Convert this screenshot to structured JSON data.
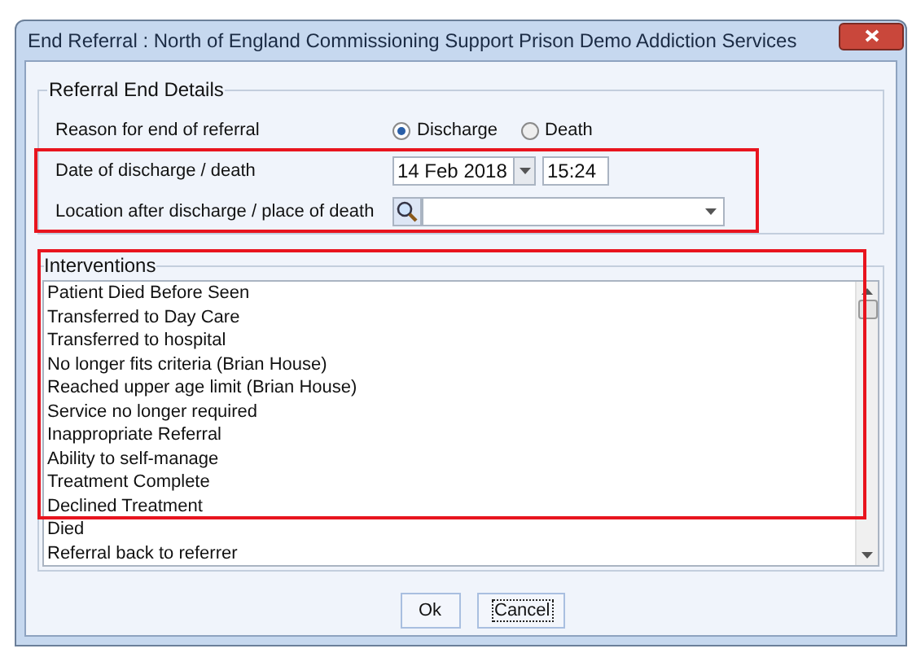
{
  "window": {
    "title": "End Referral : North of England Commissioning Support Prison Demo Addiction Services"
  },
  "details": {
    "title": "Referral End Details",
    "reason_label": "Reason for end of referral",
    "reasons": [
      {
        "label": "Discharge",
        "selected": true
      },
      {
        "label": "Death",
        "selected": false
      }
    ],
    "date_label": "Date of discharge / death",
    "date": "14 Feb 2018",
    "time": "15:24",
    "location_label": "Location after discharge / place of death"
  },
  "interventions": {
    "title": "Interventions",
    "items": [
      "Patient Died Before Seen",
      "Transferred to Day Care",
      "Transferred to hospital",
      "No longer fits criteria (Brian House)",
      "Reached upper age limit (Brian House)",
      "Service no longer required",
      "Inappropriate Referral",
      "Ability to self-manage",
      "Treatment Complete",
      "Declined Treatment",
      "Died",
      "Referral back to referrer"
    ]
  },
  "buttons": [
    {
      "label": "Ok",
      "focused": false
    },
    {
      "label": "Cancel",
      "focused": true
    }
  ]
}
